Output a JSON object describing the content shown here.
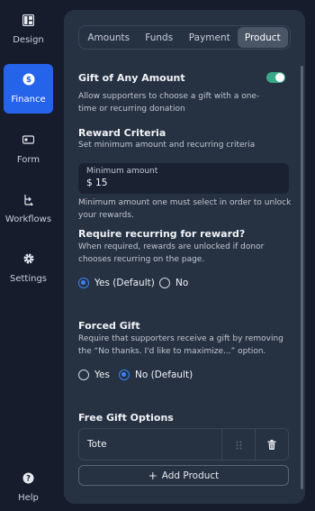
{
  "sidebar": {
    "items": [
      {
        "label": "Design",
        "icon": "layout-icon"
      },
      {
        "label": "Finance",
        "icon": "dollar-circle-icon",
        "active": true
      },
      {
        "label": "Form",
        "icon": "form-field-icon"
      },
      {
        "label": "Workflows",
        "icon": "workflow-icon"
      },
      {
        "label": "Settings",
        "icon": "gear-icon"
      },
      {
        "label": "Help",
        "icon": "question-circle-icon"
      }
    ]
  },
  "tabs": [
    {
      "label": "Amounts"
    },
    {
      "label": "Funds"
    },
    {
      "label": "Payment"
    },
    {
      "label": "Product",
      "active": true
    }
  ],
  "gift_any_amount": {
    "title": "Gift of Any Amount",
    "description": "Allow supporters to choose a gift with a one-time or recurring donation",
    "toggle_on": true
  },
  "reward_criteria": {
    "title": "Reward Criteria",
    "subtitle": "Set minimum amount and recurring criteria",
    "input_label": "Minimum amount",
    "input_value": "$ 15",
    "help": "Minimum amount one must select in order to unlock your rewards."
  },
  "require_recurring": {
    "title": "Require recurring for reward?",
    "description": "When required, rewards are unlocked if donor chooses recurring on the page.",
    "options": [
      {
        "label": "Yes (Default)",
        "checked": true
      },
      {
        "label": "No",
        "checked": false
      }
    ]
  },
  "forced_gift": {
    "title": "Forced Gift",
    "description": "Require that supporters receive a gift by removing the “No thanks. I'd like to maximize...” option.",
    "options": [
      {
        "label": "Yes",
        "checked": false
      },
      {
        "label": "No (Default)",
        "checked": true
      }
    ]
  },
  "free_gift_options": {
    "title": "Free Gift Options",
    "items": [
      {
        "name": "Tote"
      }
    ],
    "add_label": "Add Product"
  },
  "colors": {
    "background": "#161c2c",
    "panel": "#263141",
    "accent": "#2563eb",
    "toggle": "#3aa98a"
  }
}
